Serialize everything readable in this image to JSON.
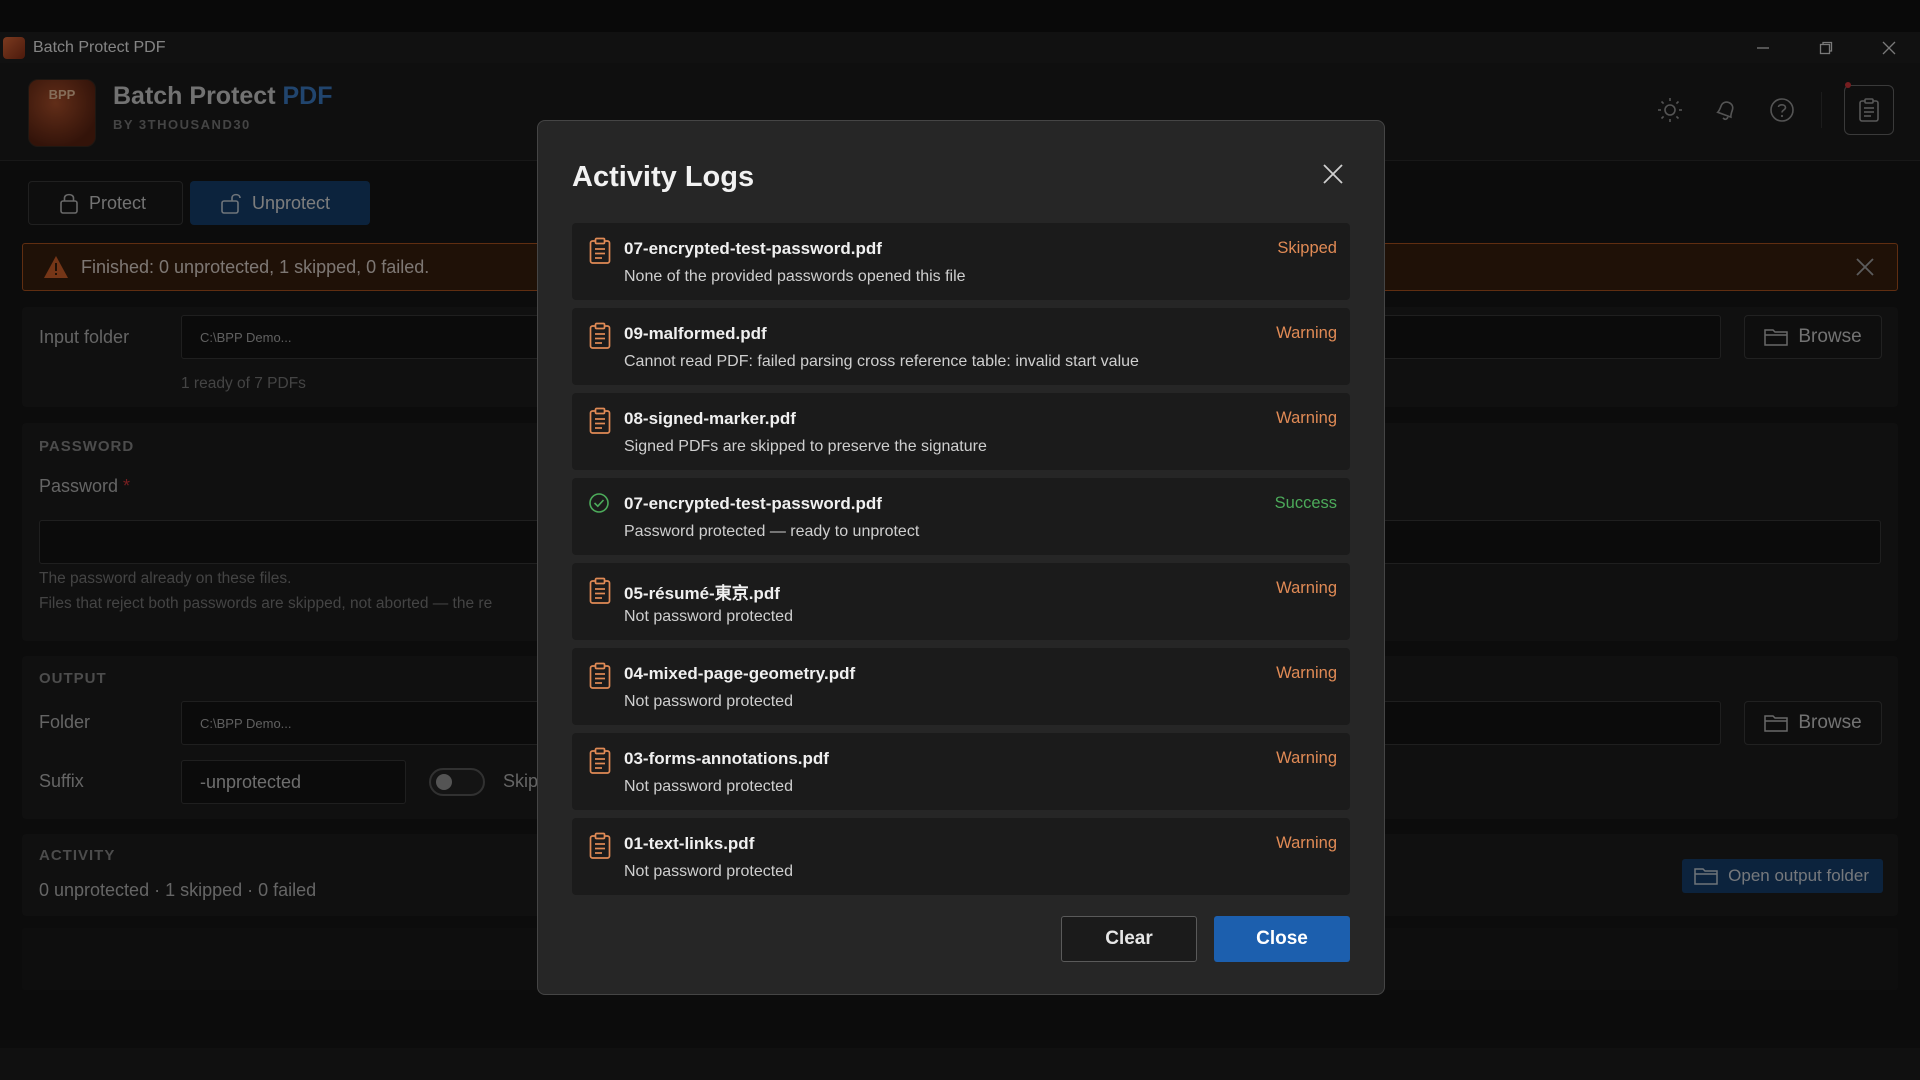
{
  "window": {
    "title": "Batch Protect PDF"
  },
  "header": {
    "logo_text": "BPP",
    "brand_main": "Batch Protect",
    "brand_accent": "PDF",
    "byline": "BY 3THOUSAND30",
    "icons": [
      "sun-icon",
      "bell-icon",
      "help-icon",
      "clipboard-icon"
    ]
  },
  "tabs": [
    {
      "label": "Protect",
      "active": false
    },
    {
      "label": "Unprotect",
      "active": true
    }
  ],
  "banner": {
    "text": "Finished: 0 unprotected, 1 skipped, 0 failed."
  },
  "input": {
    "label": "Input folder",
    "value": "C:\\BPP Demo...",
    "status": "1 ready of 7 PDFs",
    "browse": "Browse"
  },
  "password": {
    "section": "PASSWORD",
    "label": "Password",
    "required": "*",
    "hint1": "The password already on these files.",
    "hint2": "Files that reject both passwords are skipped, not aborted — the re"
  },
  "output": {
    "section": "OUTPUT",
    "folder_label": "Folder",
    "folder_value": "C:\\BPP Demo...",
    "browse": "Browse",
    "suffix_label": "Suffix",
    "suffix_value": "-unprotected",
    "toggle_label": "Skip"
  },
  "activity": {
    "section": "ACTIVITY",
    "summary": "0 unprotected · 1 skipped · 0 failed",
    "open_output": "Open output folder"
  },
  "modal": {
    "title": "Activity Logs",
    "entries": [
      {
        "file": "07-encrypted-test-password.pdf",
        "message": "None of the provided passwords opened this file",
        "status": "Skipped",
        "kind": "skip"
      },
      {
        "file": "09-malformed.pdf",
        "message": "Cannot read PDF: failed parsing cross reference table: invalid start value",
        "status": "Warning",
        "kind": "warn"
      },
      {
        "file": "08-signed-marker.pdf",
        "message": "Signed PDFs are skipped to preserve the signature",
        "status": "Warning",
        "kind": "warn"
      },
      {
        "file": "07-encrypted-test-password.pdf",
        "message": "Password protected — ready to unprotect",
        "status": "Success",
        "kind": "ok"
      },
      {
        "file": "05-résumé-東京.pdf",
        "message": "Not password protected",
        "status": "Warning",
        "kind": "warn"
      },
      {
        "file": "04-mixed-page-geometry.pdf",
        "message": "Not password protected",
        "status": "Warning",
        "kind": "warn"
      },
      {
        "file": "03-forms-annotations.pdf",
        "message": "Not password protected",
        "status": "Warning",
        "kind": "warn"
      },
      {
        "file": "01-text-links.pdf",
        "message": "Not password protected",
        "status": "Warning",
        "kind": "warn"
      }
    ],
    "clear_label": "Clear",
    "close_label": "Close"
  },
  "colors": {
    "accent": "#1c5fae",
    "warning": "#e08a55",
    "success": "#4caa5a",
    "banner_border": "#b0541f"
  }
}
